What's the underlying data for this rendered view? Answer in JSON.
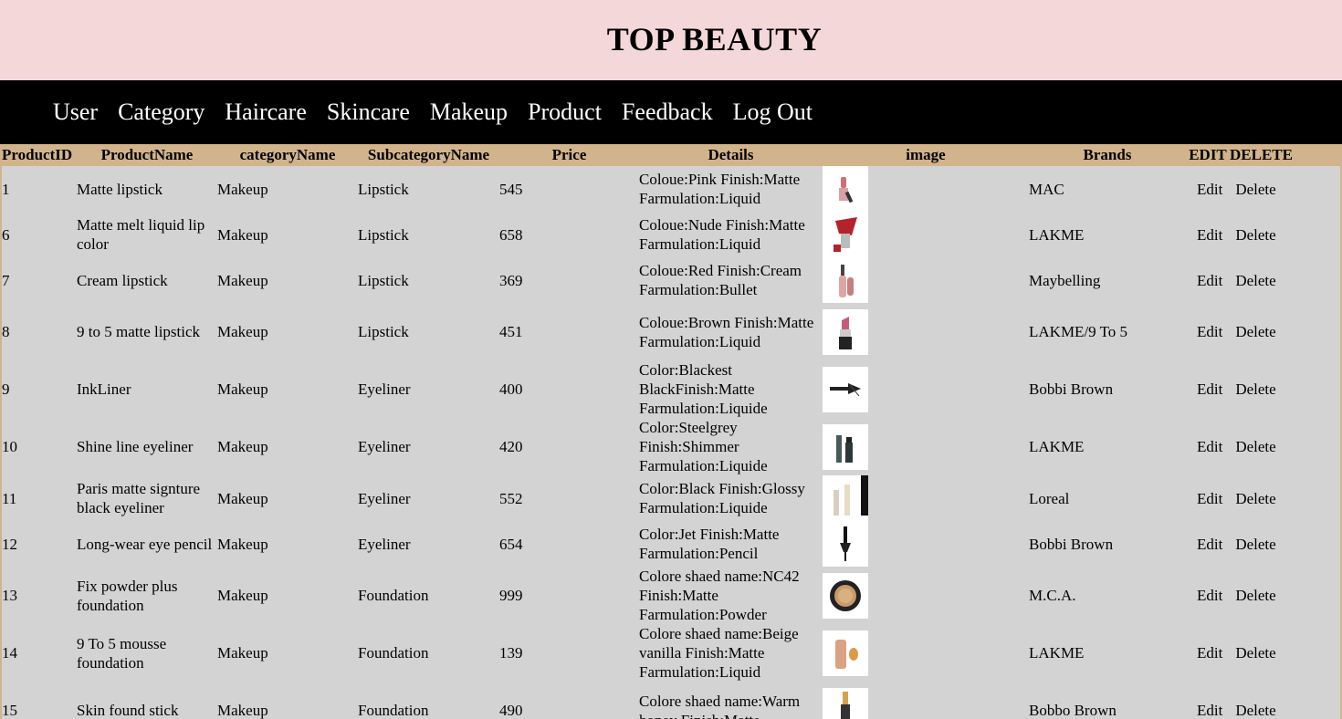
{
  "site": {
    "title": "TOP BEAUTY"
  },
  "nav": {
    "items": [
      {
        "label": "User"
      },
      {
        "label": "Category"
      },
      {
        "label": "Haircare"
      },
      {
        "label": "Skincare"
      },
      {
        "label": "Makeup"
      },
      {
        "label": "Product"
      },
      {
        "label": "Feedback"
      },
      {
        "label": "Log Out"
      }
    ]
  },
  "table": {
    "headers": {
      "id": "ProductID",
      "name": "ProductName",
      "category": "categoryName",
      "subcategory": "SubcategoryName",
      "price": "Price",
      "details": "Details",
      "image": "image",
      "brands": "Brands",
      "edit": "EDIT",
      "delete": "DELETE"
    },
    "edit_label": "Edit",
    "delete_label": "Delete",
    "rows": [
      {
        "id": "1",
        "name": "Matte lipstick",
        "category": "Makeup",
        "subcategory": "Lipstick",
        "price": "545",
        "details": "Coloue:Pink Finish:Matte Farmulation:Liquid",
        "image_icon": "lipstick-pink-icon",
        "brand": "MAC"
      },
      {
        "id": "6",
        "name": "Matte melt liquid lip color",
        "category": "Makeup",
        "subcategory": "Lipstick",
        "price": "658",
        "details": "Coloue:Nude Finish:Matte Farmulation:Liquid",
        "image_icon": "lipstick-red-icon",
        "brand": "LAKME"
      },
      {
        "id": "7",
        "name": "Cream lipstick",
        "category": "Makeup",
        "subcategory": "Lipstick",
        "price": "369",
        "details": "Coloue:Red Finish:Cream Farmulation:Bullet",
        "image_icon": "lip-gloss-icon",
        "brand": "Maybelling"
      },
      {
        "id": "8",
        "name": "9 to 5 matte lipstick",
        "category": "Makeup",
        "subcategory": "Lipstick",
        "price": "451",
        "details": "Coloue:Brown Finish:Matte Farmulation:Liquid",
        "image_icon": "lipstick-bullet-icon",
        "brand": "LAKME/9 To 5"
      },
      {
        "id": "9",
        "name": "InkLiner",
        "category": "Makeup",
        "subcategory": "Eyeliner",
        "price": "400",
        "details": "Color:Blackest BlackFinish:Matte Farmulation:Liquide",
        "image_icon": "eyeliner-stroke-icon",
        "brand": "Bobbi Brown"
      },
      {
        "id": "10",
        "name": "Shine line eyeliner",
        "category": "Makeup",
        "subcategory": "Eyeliner",
        "price": "420",
        "details": "Color:Steelgrey Finish:Shimmer Farmulation:Liquide",
        "image_icon": "eyeliner-bottle-icon",
        "brand": "LAKME"
      },
      {
        "id": "11",
        "name": "Paris matte signture black eyeliner",
        "category": "Makeup",
        "subcategory": "Eyeliner",
        "price": "552",
        "details": "Color:Black Finish:Glossy Farmulation:Liquide",
        "image_icon": "eyeliner-pen-icon",
        "brand": "Loreal"
      },
      {
        "id": "12",
        "name": "Long-wear eye pencil",
        "category": "Makeup",
        "subcategory": "Eyeliner",
        "price": "654",
        "details": "Color:Jet Finish:Matte Farmulation:Pencil",
        "image_icon": "eye-pencil-icon",
        "brand": "Bobbi Brown"
      },
      {
        "id": "13",
        "name": "Fix powder plus foundation",
        "category": "Makeup",
        "subcategory": "Foundation",
        "price": "999",
        "details": "Colore shaed name:NC42 Finish:Matte Farmulation:Powder",
        "image_icon": "powder-compact-icon",
        "brand": "M.C.A."
      },
      {
        "id": "14",
        "name": "9 To 5 mousse foundation",
        "category": "Makeup",
        "subcategory": "Foundation",
        "price": "139",
        "details": "Colore shaed name:Beige vanilla Finish:Matte Farmulation:Liquid",
        "image_icon": "foundation-tube-icon",
        "brand": "LAKME"
      },
      {
        "id": "15",
        "name": "Skin found stick",
        "category": "Makeup",
        "subcategory": "Foundation",
        "price": "490",
        "details": "Colore shaed name:Warm honey Finish:Matte",
        "image_icon": "foundation-stick-icon",
        "brand": "Bobbo Brown"
      }
    ]
  }
}
